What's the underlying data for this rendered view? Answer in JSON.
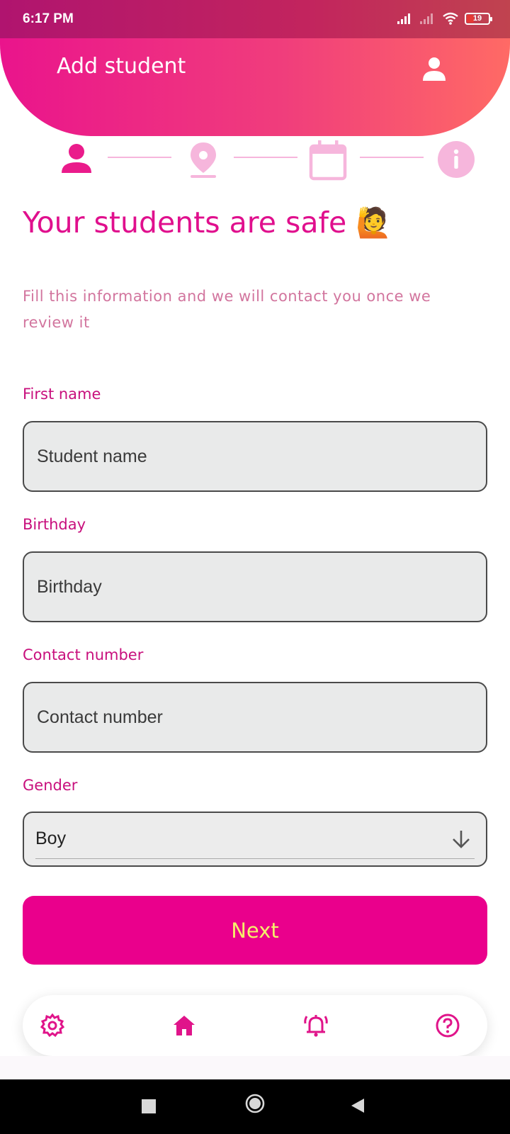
{
  "status_bar": {
    "time": "6:17 PM",
    "battery": "19",
    "icons": [
      "signal-icon",
      "signal-weak-icon",
      "wifi-icon",
      "battery-icon"
    ]
  },
  "header": {
    "title": "Add student",
    "avatar_icon": "person-icon"
  },
  "stepper": {
    "steps": [
      {
        "icon": "person-icon",
        "state": "active"
      },
      {
        "icon": "location-pin-icon",
        "state": "inactive"
      },
      {
        "icon": "calendar-icon",
        "state": "inactive"
      },
      {
        "icon": "info-icon",
        "state": "inactive"
      }
    ]
  },
  "hero": {
    "title": "Your students are safe 🙋",
    "subtitle": "Fill this information and we will contact you once we review it"
  },
  "form": {
    "first_name": {
      "label": "First name",
      "placeholder": "Student name"
    },
    "birthday": {
      "label": "Birthday",
      "placeholder": "Birthday"
    },
    "contact": {
      "label": "Contact number",
      "placeholder": "Contact number"
    },
    "gender": {
      "label": "Gender",
      "value": "Boy"
    },
    "next_label": "Next"
  },
  "bottom_nav": {
    "items": [
      "settings-gear-icon",
      "home-icon",
      "alarm-bell-icon",
      "help-icon"
    ]
  },
  "colors": {
    "primary": "#ea008c",
    "label": "#c8107d",
    "step_inactive": "#f6b6dc",
    "next_text": "#f5f26a"
  }
}
